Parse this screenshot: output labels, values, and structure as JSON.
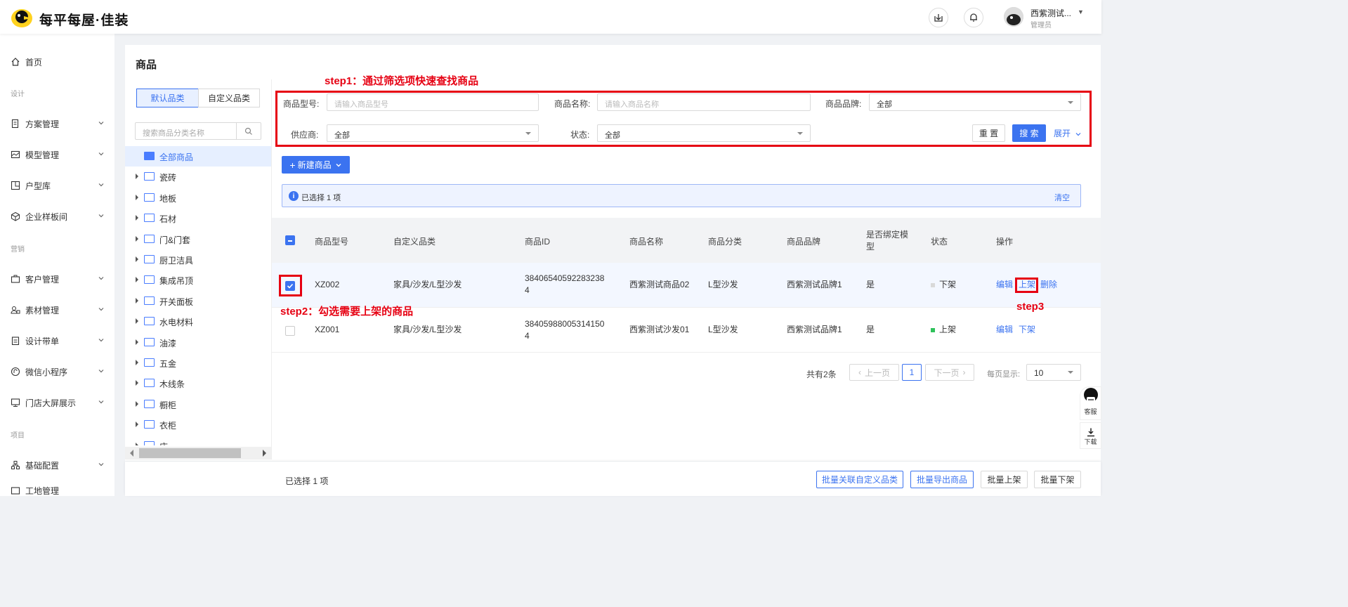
{
  "header": {
    "brand": "每平每屋·佳装",
    "user_name": "西紫测试...",
    "user_role": "管理员"
  },
  "sidebar": {
    "home": "首页",
    "group_design": "设计",
    "items_design": [
      "方案管理",
      "模型管理",
      "户型库",
      "企业样板间"
    ],
    "group_marketing": "营销",
    "items_marketing": [
      "客户管理",
      "素材管理",
      "设计带单",
      "微信小程序",
      "门店大屏展示"
    ],
    "group_project": "项目",
    "items_project": [
      "基础配置",
      "工地管理"
    ]
  },
  "page": {
    "title": "商品",
    "tab_default": "默认品类",
    "tab_custom": "自定义品类",
    "category_search_placeholder": "搜索商品分类名称"
  },
  "tree": [
    "全部商品",
    "瓷砖",
    "地板",
    "石材",
    "门&门套",
    "厨卫洁具",
    "集成吊顶",
    "开关面板",
    "水电材料",
    "油漆",
    "五金",
    "木线条",
    "橱柜",
    "衣柜",
    "床"
  ],
  "filters": {
    "model_label": "商品型号:",
    "model_placeholder": "请输入商品型号",
    "name_label": "商品名称:",
    "name_placeholder": "请输入商品名称",
    "brand_label": "商品品牌:",
    "brand_value": "全部",
    "supplier_label": "供应商:",
    "supplier_value": "全部",
    "status_label": "状态:",
    "status_value": "全部",
    "reset": "重 置",
    "search": "搜 索",
    "expand": "展开"
  },
  "new_button": "新建商品",
  "alert": {
    "text": "已选择 1 项",
    "clear": "清空"
  },
  "table": {
    "headers": [
      "商品型号",
      "自定义品类",
      "商品ID",
      "商品名称",
      "商品分类",
      "商品品牌",
      "是否绑定模型",
      "状态",
      "操作"
    ],
    "rows": [
      {
        "model": "XZ002",
        "custom_category": "家具/沙发/L型沙发",
        "id": "384065405922832384",
        "name": "西紫测试商品02",
        "category": "L型沙发",
        "brand": "西紫测试品牌1",
        "bound": "是",
        "status": "下架",
        "status_color": "#d9d9d9",
        "actions": [
          "编辑",
          "上架",
          "删除"
        ],
        "checked": true
      },
      {
        "model": "XZ001",
        "custom_category": "家具/沙发/L型沙发",
        "id": "384059880053141504",
        "name": "西紫测试沙发01",
        "category": "L型沙发",
        "brand": "西紫测试品牌1",
        "bound": "是",
        "status": "上架",
        "status_color": "#2fc25b",
        "actions": [
          "编辑",
          "下架"
        ],
        "checked": false
      }
    ]
  },
  "pagination": {
    "total": "共有2条",
    "prev": "上一页",
    "current": "1",
    "next": "下一页",
    "per_page_label": "每页显示:",
    "per_page": "10"
  },
  "footer": {
    "selected": "已选择 1 项",
    "buttons": [
      "批量关联自定义品类",
      "批量导出商品",
      "批量上架",
      "批量下架"
    ]
  },
  "float_buttons": {
    "service": "客服",
    "download": "下载"
  },
  "annotations": {
    "step1": "step1：通过筛选项快速查找商品",
    "step2": "step2：勾选需要上架的商品",
    "step3": "step3"
  },
  "colors": {
    "accent": "#3b73f0",
    "annotation": "#e60012"
  }
}
